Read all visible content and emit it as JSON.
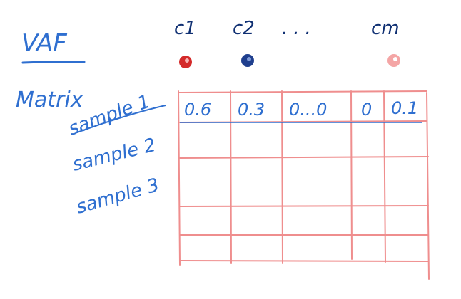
{
  "title": "VAF",
  "matrix_label": "Matrix",
  "columns": [
    "c1",
    "c2",
    "...",
    "cm"
  ],
  "colors": {
    "ink": "#2f6fd0",
    "ink_dark": "#0f2f72",
    "grid": "#ef8e8e",
    "c1": "#d42a2a",
    "c2": "#1f3f8e",
    "cm": "#f4a5a5"
  },
  "rows": [
    {
      "label": "sample 1",
      "values": [
        "0.6",
        "0.3",
        "0...0",
        "0",
        "0.1"
      ]
    },
    {
      "label": "sample 2",
      "values": []
    },
    {
      "label": "sample 3",
      "values": []
    }
  ]
}
